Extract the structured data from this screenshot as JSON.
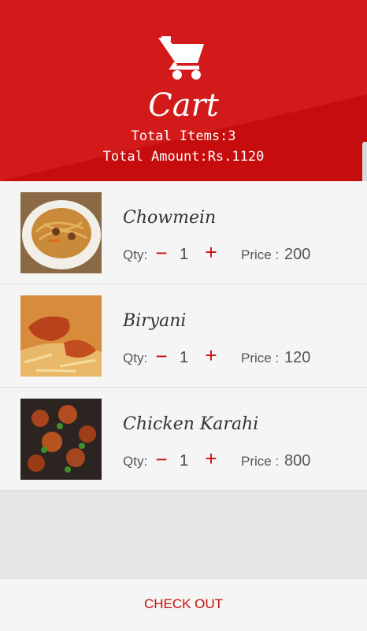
{
  "header": {
    "title": "Cart",
    "total_items": "Total Items:3",
    "total_amount": "Total Amount:Rs.1120",
    "icon": "cart-icon"
  },
  "colors": {
    "accent": "#c60c0c",
    "row_bg": "#f5f5f5",
    "empty_bg": "#e6e6e6"
  },
  "items": [
    {
      "name": "Chowmein",
      "qty_label": "Qty:",
      "minus": "−",
      "qty": "1",
      "plus": "+",
      "price_label": "Price :",
      "price": "200"
    },
    {
      "name": "Biryani",
      "qty_label": "Qty:",
      "minus": "−",
      "qty": "1",
      "plus": "+",
      "price_label": "Price :",
      "price": "120"
    },
    {
      "name": "Chicken Karahi",
      "qty_label": "Qty:",
      "minus": "−",
      "qty": "1",
      "plus": "+",
      "price_label": "Price :",
      "price": "800"
    }
  ],
  "footer": {
    "checkout_label": "CHECK OUT"
  }
}
